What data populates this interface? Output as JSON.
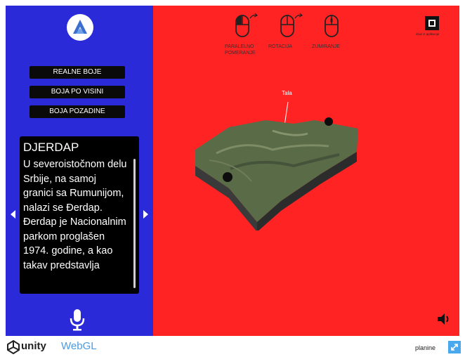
{
  "sidebar": {
    "buttons": [
      {
        "label": "REALNE BOJE"
      },
      {
        "label": "BOJA PO VISINI"
      },
      {
        "label": "BOJA POZADINE"
      }
    ],
    "info": {
      "title": "DJERDAP",
      "text": "U severoistočnom delu Srbije, na samoj granici sa Rumunijom, nalazi se Đerdap. Đerdap je Nacionalnim parkom proglašen 1974. godine, a kao takav predstavlja"
    }
  },
  "controls": [
    {
      "label": "PARALELNO POMERANJE",
      "icon": "mouse-icon"
    },
    {
      "label": "ROTACIJA",
      "icon": "mouse-icon"
    },
    {
      "label": "ZUMIRANJE",
      "icon": "mouse-icon"
    }
  ],
  "viewport": {
    "exit_label": "izlaz iz aplikacije",
    "pin_label": "Tala"
  },
  "footer": {
    "brand": "unity",
    "brand_suffix": "WebGL",
    "title": "planine"
  },
  "colors": {
    "sidebar_bg": "#2a2ad8",
    "viewport_bg": "#ff2323",
    "button_bg": "#0a0a0a",
    "webgl_blue": "#4a9be0"
  }
}
